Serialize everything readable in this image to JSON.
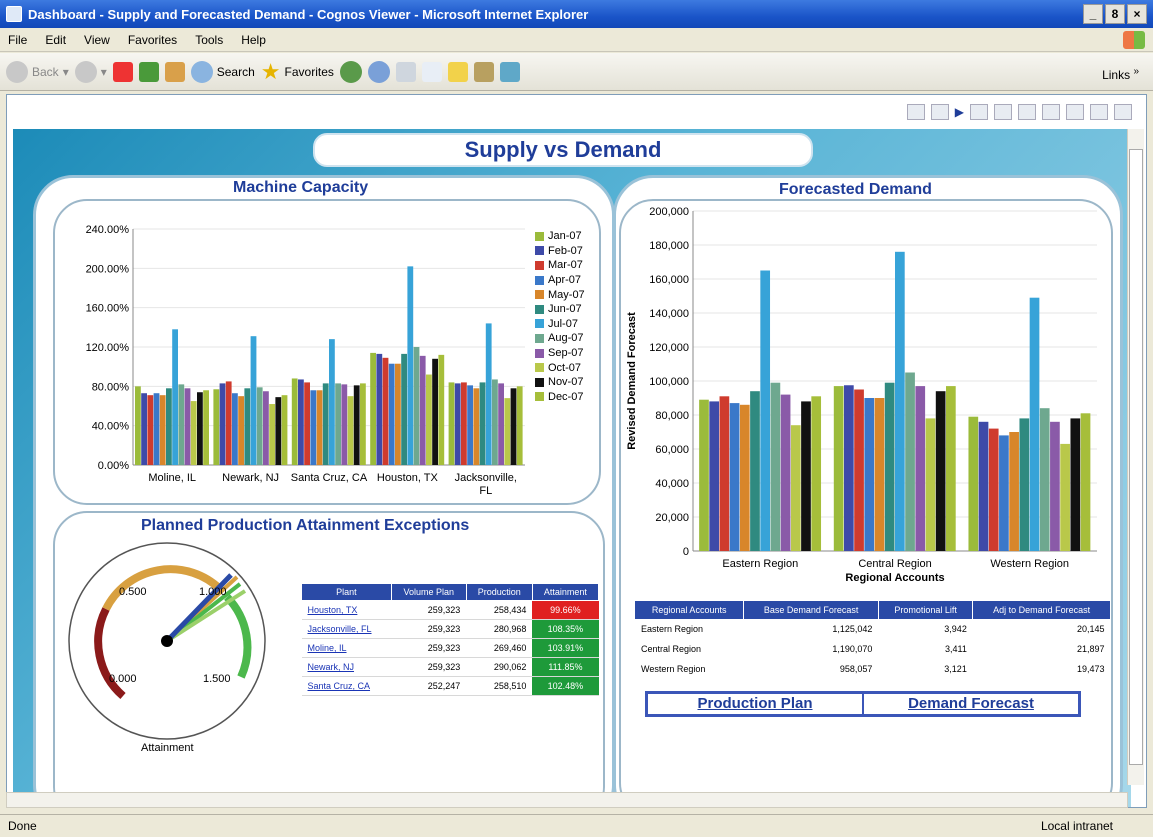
{
  "window": {
    "title": "Dashboard - Supply and Forecasted Demand - Cognos Viewer - Microsoft Internet Explorer",
    "min": "_",
    "max": "8",
    "close": "×"
  },
  "menu": [
    "File",
    "Edit",
    "View",
    "Favorites",
    "Tools",
    "Help"
  ],
  "toolbar": {
    "back": "Back",
    "search": "Search",
    "favorites": "Favorites",
    "links": "Links",
    "chevron": "»"
  },
  "dashboard": {
    "title": "Supply vs Demand"
  },
  "machine_capacity": {
    "title": "Machine Capacity",
    "yticks": [
      "240.00%",
      "200.00%",
      "160.00%",
      "120.00%",
      "80.00%",
      "40.00%",
      "0.00%"
    ],
    "months": [
      "Jan-07",
      "Feb-07",
      "Mar-07",
      "Apr-07",
      "May-07",
      "Jun-07",
      "Jul-07",
      "Aug-07",
      "Sep-07",
      "Oct-07",
      "Nov-07",
      "Dec-07"
    ],
    "colors": [
      "#9bbb3b",
      "#3e4aa8",
      "#cf3b2e",
      "#3a78c9",
      "#d8862a",
      "#2f8a80",
      "#37a3d8",
      "#6ea88f",
      "#8a5aa8",
      "#b9c84a",
      "#111111",
      "#a6be3a"
    ],
    "categories": [
      "Moline, IL",
      "Newark, NJ",
      "Santa Cruz, CA",
      "Houston, TX",
      "Jacksonville, FL"
    ],
    "category_lines": [
      [
        "Moline, IL"
      ],
      [
        "Newark, NJ"
      ],
      [
        "Santa Cruz, CA"
      ],
      [
        "Houston, TX"
      ],
      [
        "Jacksonville,",
        "FL"
      ]
    ]
  },
  "chart_data": [
    {
      "type": "bar",
      "title": "Machine Capacity",
      "categories": [
        "Moline, IL",
        "Newark, NJ",
        "Santa Cruz, CA",
        "Houston, TX",
        "Jacksonville, FL"
      ],
      "ylim": [
        0,
        240
      ],
      "series": [
        {
          "name": "Jan-07",
          "values": [
            80,
            77,
            88,
            114,
            84
          ]
        },
        {
          "name": "Feb-07",
          "values": [
            73,
            83,
            87,
            113,
            83
          ]
        },
        {
          "name": "Mar-07",
          "values": [
            71,
            85,
            84,
            109,
            84
          ]
        },
        {
          "name": "Apr-07",
          "values": [
            73,
            73,
            76,
            103,
            81
          ]
        },
        {
          "name": "May-07",
          "values": [
            71,
            70,
            76,
            103,
            78
          ]
        },
        {
          "name": "Jun-07",
          "values": [
            78,
            78,
            83,
            113,
            84
          ]
        },
        {
          "name": "Jul-07",
          "values": [
            138,
            131,
            128,
            202,
            144
          ]
        },
        {
          "name": "Aug-07",
          "values": [
            82,
            79,
            83,
            120,
            87
          ]
        },
        {
          "name": "Sep-07",
          "values": [
            78,
            75,
            82,
            111,
            83
          ]
        },
        {
          "name": "Oct-07",
          "values": [
            65,
            62,
            70,
            92,
            68
          ]
        },
        {
          "name": "Nov-07",
          "values": [
            74,
            69,
            81,
            108,
            78
          ]
        },
        {
          "name": "Dec-07",
          "values": [
            76,
            71,
            83,
            112,
            80
          ]
        }
      ]
    },
    {
      "type": "bar",
      "title": "Forecasted Demand",
      "xlabel": "Regional Accounts",
      "ylabel": "Revised Demand Forecast",
      "categories": [
        "Eastern Region",
        "Central Region",
        "Western Region"
      ],
      "ylim": [
        0,
        200000
      ],
      "series": [
        {
          "name": "Jan-07",
          "values": [
            89000,
            97000,
            79000
          ]
        },
        {
          "name": "Feb-07",
          "values": [
            88000,
            97500,
            76000
          ]
        },
        {
          "name": "Mar-07",
          "values": [
            91000,
            95000,
            72000
          ]
        },
        {
          "name": "Apr-07",
          "values": [
            87000,
            90000,
            68000
          ]
        },
        {
          "name": "May-07",
          "values": [
            86000,
            90000,
            70000
          ]
        },
        {
          "name": "Jun-07",
          "values": [
            94000,
            99000,
            78000
          ]
        },
        {
          "name": "Jul-07",
          "values": [
            165000,
            176000,
            149000
          ]
        },
        {
          "name": "Aug-07",
          "values": [
            99000,
            105000,
            84000
          ]
        },
        {
          "name": "Sep-07",
          "values": [
            92000,
            97000,
            76000
          ]
        },
        {
          "name": "Oct-07",
          "values": [
            74000,
            78000,
            63000
          ]
        },
        {
          "name": "Nov-07",
          "values": [
            88000,
            94000,
            78000
          ]
        },
        {
          "name": "Dec-07",
          "values": [
            91000,
            97000,
            81000
          ]
        }
      ]
    }
  ],
  "forecast": {
    "title": "Forecasted Demand",
    "yticks": [
      "200,000",
      "180,000",
      "160,000",
      "140,000",
      "120,000",
      "100,000",
      "80,000",
      "60,000",
      "40,000",
      "20,000",
      "0"
    ],
    "ylabel": "Revised Demand Forecast",
    "xlabel": "Regional Accounts",
    "categories": [
      "Eastern Region",
      "Central Region",
      "Western Region"
    ]
  },
  "exceptions": {
    "title": "Planned Production Attainment Exceptions",
    "gauge": {
      "label": "Attainment",
      "ticks": [
        "0.000",
        "0.500",
        "1.000",
        "1.500"
      ]
    },
    "headers": [
      "Plant",
      "Volume Plan",
      "Production",
      "Attainment"
    ],
    "rows": [
      {
        "plant": "Houston, TX",
        "plan": "259,323",
        "prod": "258,434",
        "att": "99.66%",
        "color": "#e02020"
      },
      {
        "plant": "Jacksonville, FL",
        "plan": "259,323",
        "prod": "280,968",
        "att": "108.35%",
        "color": "#1e9a3a"
      },
      {
        "plant": "Moline, IL",
        "plan": "259,323",
        "prod": "269,460",
        "att": "103.91%",
        "color": "#1e9a3a"
      },
      {
        "plant": "Newark, NJ",
        "plan": "259,323",
        "prod": "290,062",
        "att": "111.85%",
        "color": "#1e9a3a"
      },
      {
        "plant": "Santa Cruz, CA",
        "plan": "252,247",
        "prod": "258,510",
        "att": "102.48%",
        "color": "#1e9a3a"
      }
    ]
  },
  "regional": {
    "headers": [
      "Regional Accounts",
      "Base Demand Forecast",
      "Promotional Lift",
      "Adj to Demand Forecast"
    ],
    "rows": [
      [
        "Eastern Region",
        "1,125,042",
        "3,942",
        "20,145"
      ],
      [
        "Central Region",
        "1,190,070",
        "3,411",
        "21,897"
      ],
      [
        "Western Region",
        "958,057",
        "3,121",
        "19,473"
      ]
    ]
  },
  "nav": {
    "production_plan": "Production Plan",
    "demand_forecast": "Demand Forecast"
  },
  "status": {
    "left": "Done",
    "right": "Local intranet"
  }
}
